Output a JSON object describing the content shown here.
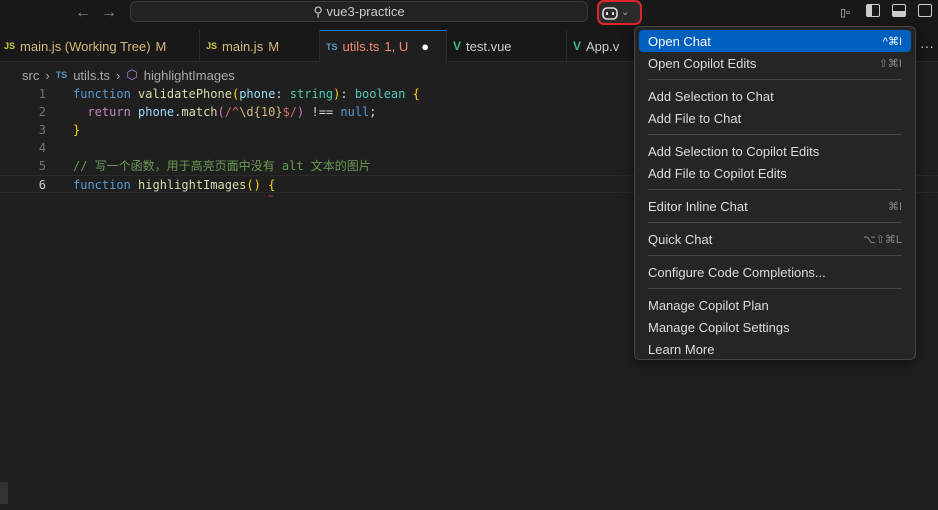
{
  "titlebar": {
    "back": "←",
    "forward": "→",
    "search": "vue3-practice",
    "copilot_icon": "copilot-icon",
    "chevron": "⌄"
  },
  "tabs": [
    {
      "badge": "JS",
      "label": "main.js (Working Tree)",
      "status": "M",
      "type": "js"
    },
    {
      "badge": "JS",
      "label": "main.js",
      "status": "M",
      "type": "js"
    },
    {
      "badge": "TS",
      "label": "utils.ts",
      "status": "1, U",
      "type": "ts",
      "active": true,
      "dirty": "●"
    },
    {
      "badge": "V",
      "label": "test.vue",
      "status": "",
      "type": "vue"
    },
    {
      "badge": "V",
      "label": "App.v",
      "status": "",
      "type": "vue"
    }
  ],
  "more": "···",
  "breadcrumb": {
    "folder": "src",
    "file_badge": "TS",
    "file": "utils.ts",
    "symbol": "highlightImages"
  },
  "code": [
    {
      "n": "1",
      "tokens": [
        [
          "kw",
          "function "
        ],
        [
          "fn",
          "validatePhone"
        ],
        [
          "br1",
          "("
        ],
        [
          "var",
          "phone"
        ],
        [
          "pl",
          ": "
        ],
        [
          "type",
          "string"
        ],
        [
          "br1",
          ")"
        ],
        [
          "pl",
          ": "
        ],
        [
          "type",
          "boolean"
        ],
        [
          "pl",
          " "
        ],
        [
          "br1",
          "{"
        ]
      ]
    },
    {
      "n": "2",
      "tokens": [
        [
          "pl",
          "  "
        ],
        [
          "ctl",
          "return "
        ],
        [
          "var",
          "phone"
        ],
        [
          "pl",
          "."
        ],
        [
          "fn",
          "match"
        ],
        [
          "br2",
          "("
        ],
        [
          "str",
          "/^"
        ],
        [
          "esc",
          "\\d{10}"
        ],
        [
          "str",
          "$/"
        ],
        [
          "br2",
          ")"
        ],
        [
          "pl",
          " !== "
        ],
        [
          "kw",
          "null"
        ],
        [
          "pl",
          ";"
        ]
      ]
    },
    {
      "n": "3",
      "tokens": [
        [
          "br1",
          "}"
        ]
      ]
    },
    {
      "n": "4",
      "tokens": []
    },
    {
      "n": "5",
      "tokens": [
        [
          "cm",
          "// 写一个函数，用于高亮页面中没有 alt 文本的图片"
        ]
      ]
    },
    {
      "n": "6",
      "tokens": [
        [
          "kw",
          "function "
        ],
        [
          "fn",
          "highlightImages"
        ],
        [
          "br1",
          "()"
        ],
        [
          "pl",
          " "
        ],
        [
          "br1",
          "{"
        ]
      ],
      "current": true
    }
  ],
  "menu": [
    {
      "label": "Open Chat",
      "key": "^⌘I",
      "selected": true
    },
    {
      "label": "Open Copilot Edits",
      "key": "⇧⌘I"
    },
    {
      "sep": true
    },
    {
      "label": "Add Selection to Chat",
      "key": ""
    },
    {
      "label": "Add File to Chat",
      "key": ""
    },
    {
      "sep": true
    },
    {
      "label": "Add Selection to Copilot Edits",
      "key": ""
    },
    {
      "label": "Add File to Copilot Edits",
      "key": ""
    },
    {
      "sep": true
    },
    {
      "label": "Editor Inline Chat",
      "key": "⌘I"
    },
    {
      "sep": true
    },
    {
      "label": "Quick Chat",
      "key": "⌥⇧⌘L"
    },
    {
      "sep": true
    },
    {
      "label": "Configure Code Completions...",
      "key": ""
    },
    {
      "sep": true
    },
    {
      "label": "Manage Copilot Plan",
      "key": ""
    },
    {
      "label": "Manage Copilot Settings",
      "key": ""
    },
    {
      "label": "Learn More",
      "key": ""
    }
  ]
}
